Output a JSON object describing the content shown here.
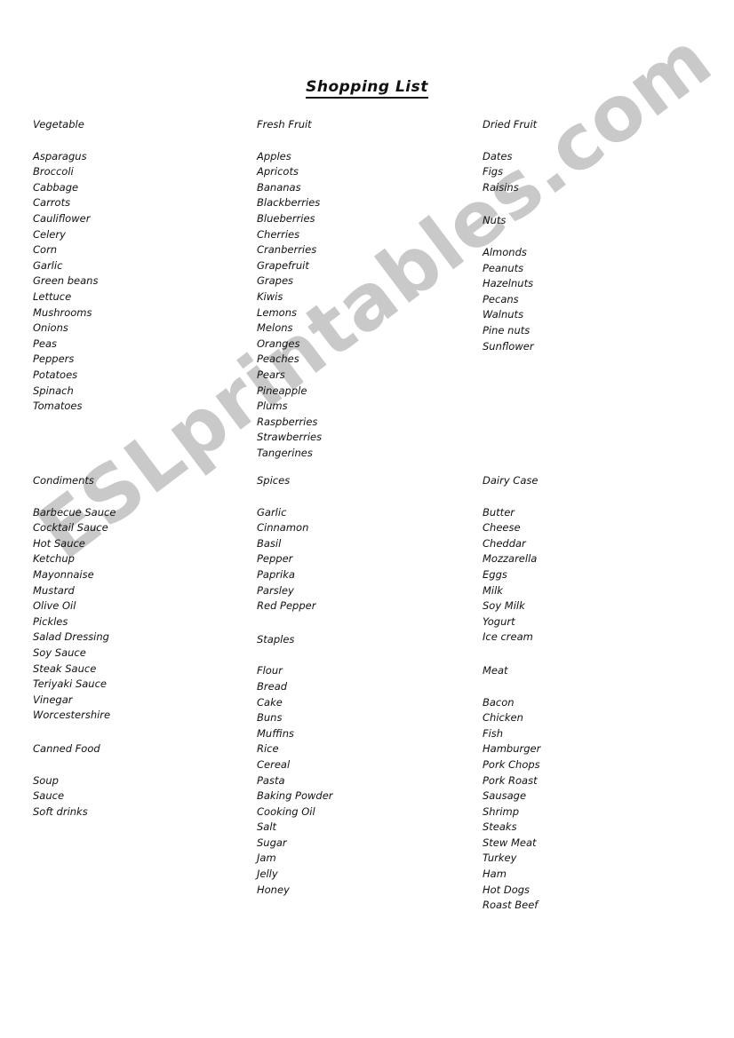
{
  "document": {
    "title": "Shopping List",
    "watermark": "ESLprintables.com",
    "colors": {
      "text": "#111111",
      "background": "#ffffff",
      "watermark": "#c9c9c9"
    }
  },
  "columns": [
    {
      "id": "column-left-top",
      "sections": [
        {
          "heading": "Vegetable",
          "items": [
            "Asparagus",
            "Broccoli",
            "Cabbage",
            "Carrots",
            "Cauliflower",
            "Celery",
            "Corn",
            "Garlic",
            "Green beans",
            "Lettuce",
            "Mushrooms",
            "Onions",
            "Peas",
            "Peppers",
            "Potatoes",
            "Spinach",
            "Tomatoes"
          ]
        }
      ]
    },
    {
      "id": "column-middle-top",
      "sections": [
        {
          "heading": "Fresh Fruit",
          "items": [
            "Apples",
            "Apricots",
            "Bananas",
            "Blackberries",
            "Blueberries",
            "Cherries",
            "Cranberries",
            "Grapefruit",
            "Grapes",
            "Kiwis",
            "Lemons",
            "Melons",
            "Oranges",
            "Peaches",
            "Pears",
            "Pineapple",
            "Plums",
            "Raspberries",
            "Strawberries",
            "Tangerines"
          ]
        }
      ]
    },
    {
      "id": "column-right-top",
      "sections": [
        {
          "heading": "Dried Fruit",
          "items": [
            "Dates",
            "Figs",
            "Raisins"
          ]
        },
        {
          "heading": "Nuts",
          "items": [
            "Almonds",
            "Peanuts",
            "Hazelnuts",
            "Pecans",
            "Walnuts",
            "Pine nuts",
            "Sunflower"
          ]
        }
      ]
    },
    {
      "id": "column-left-bottom",
      "sections": [
        {
          "heading": "Condiments",
          "items": [
            "Barbecue Sauce",
            "Cocktail Sauce",
            "Hot Sauce",
            "Ketchup",
            "Mayonnaise",
            "Mustard",
            "Olive Oil",
            "Pickles",
            "Salad Dressing",
            "Soy Sauce",
            "Steak Sauce",
            "Teriyaki Sauce",
            "Vinegar",
            "Worcestershire"
          ]
        },
        {
          "heading": "Canned Food",
          "items": [
            "Soup",
            "Sauce",
            "Soft drinks"
          ]
        }
      ]
    },
    {
      "id": "column-middle-bottom",
      "sections": [
        {
          "heading": "Spices",
          "items": [
            "Garlic",
            "Cinnamon",
            "Basil",
            "Pepper",
            "Paprika",
            "Parsley",
            "Red Pepper"
          ]
        },
        {
          "heading": "Staples",
          "items": [
            "Flour",
            "Bread",
            "Cake",
            "Buns",
            "Muffins",
            "Rice",
            "Cereal",
            "Pasta",
            "Baking Powder",
            "Cooking Oil",
            "Salt",
            "Sugar",
            "Jam",
            "Jelly",
            "Honey"
          ]
        }
      ]
    },
    {
      "id": "column-right-bottom",
      "sections": [
        {
          "heading": "Dairy Case",
          "items": [
            "Butter",
            "Cheese",
            "Cheddar",
            "Mozzarella",
            "Eggs",
            "Milk",
            "Soy Milk",
            "Yogurt",
            "Ice cream"
          ]
        },
        {
          "heading": "Meat",
          "items": [
            "Bacon",
            "Chicken",
            "Fish",
            "Hamburger",
            "Pork Chops",
            "Pork Roast",
            "Sausage",
            "Shrimp",
            "Steaks",
            "Stew Meat",
            "Turkey",
            "Ham",
            "Hot Dogs",
            "Roast Beef"
          ]
        }
      ]
    }
  ]
}
